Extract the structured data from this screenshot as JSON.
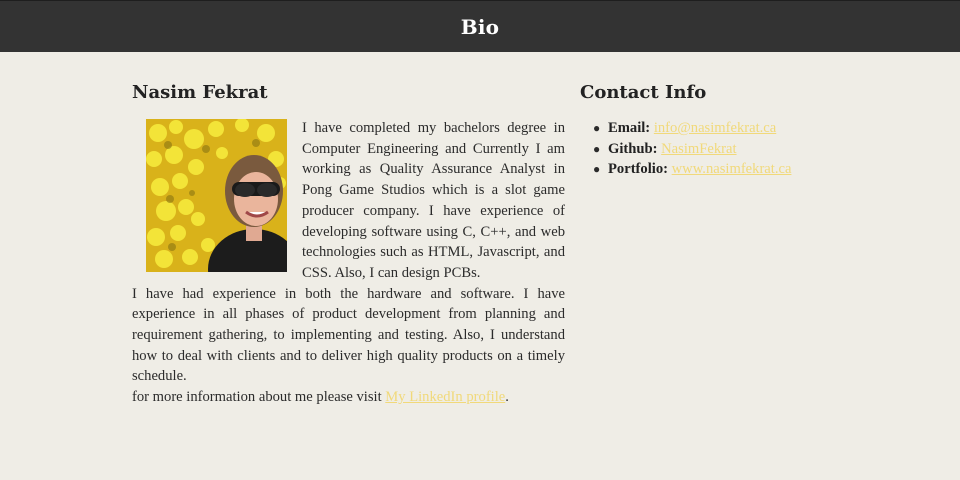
{
  "header": {
    "title": "Bio"
  },
  "bio": {
    "name": "Nasim Fekrat",
    "photo_alt": "Photo of Nasim Fekrat",
    "paragraph1": "I have completed my bachelors degree in Computer Engineering and Currently I am working as Quality Assurance Analyst in Pong Game Studios which is a slot game producer company. I have experience of developing software using C, C++, and web technologies such as HTML, Javascript, and CSS. Also, I can design PCBs.",
    "paragraph2": "I have had experience in both the hardware and software. I have experience in all phases of product development from planning and requirement gathering, to implementing and testing. Also, I understand how to deal with clients and to deliver high quality products on a timely schedule.",
    "more_info_prefix": "for more information about me please visit ",
    "linkedin_label": "My LinkedIn profile",
    "more_info_suffix": "."
  },
  "contact": {
    "title": "Contact Info",
    "items": [
      {
        "label": "Email:",
        "value": "info@nasimfekrat.ca"
      },
      {
        "label": "Github:",
        "value": "NasimFekrat"
      },
      {
        "label": "Portfolio:",
        "value": "www.nasimfekrat.ca"
      }
    ]
  },
  "colors": {
    "header_bg": "#333333",
    "page_bg": "#efede6",
    "link": "#f1d97a"
  }
}
